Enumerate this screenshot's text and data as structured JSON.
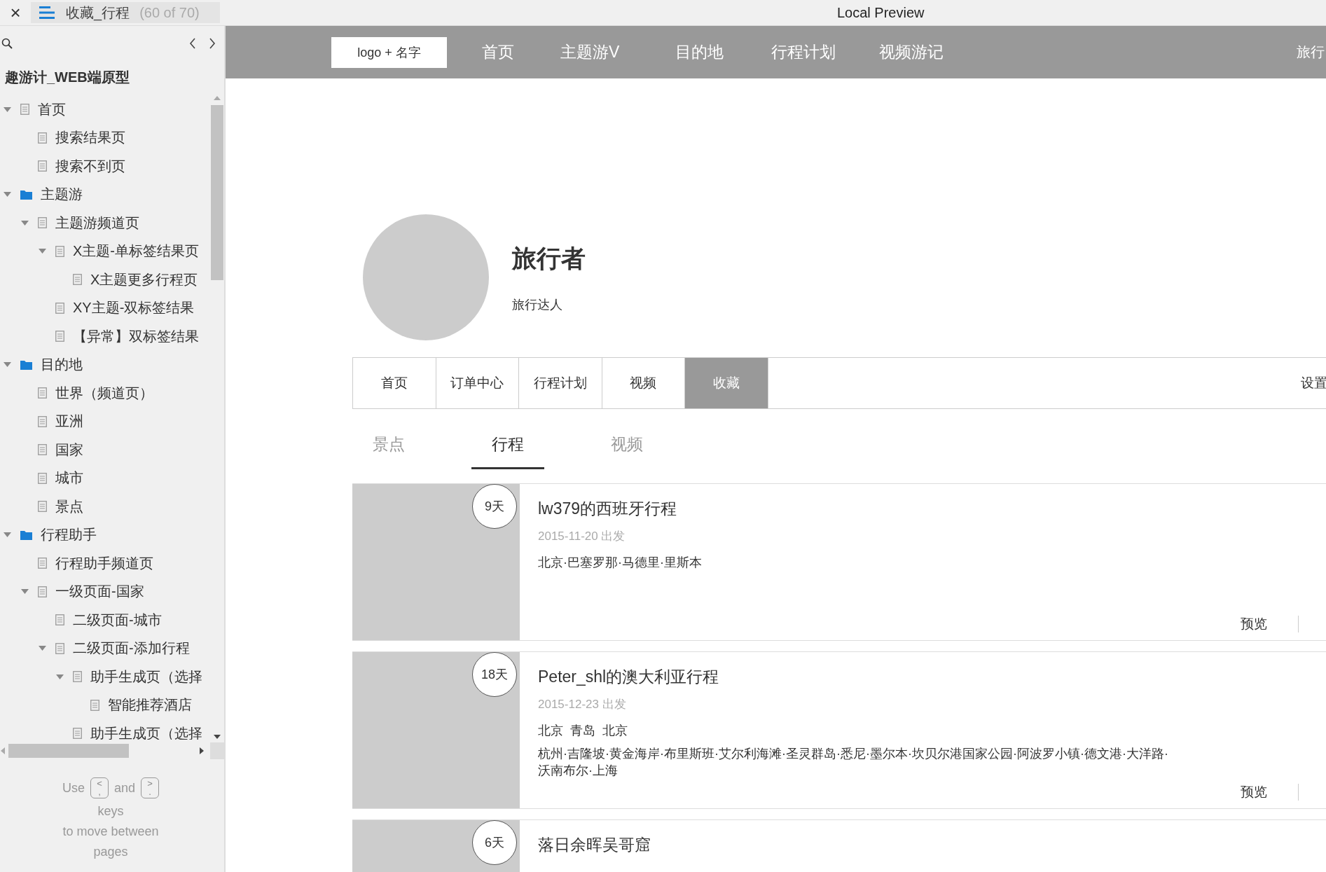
{
  "window": {
    "close": "×",
    "tab_title": "收藏_行程",
    "page_count": "(60 of 70)",
    "title": "Local Preview"
  },
  "sidebar": {
    "project": "趣游计_WEB端原型",
    "tree": [
      {
        "label": "首页",
        "kind": "page",
        "expanded": true,
        "children": [
          {
            "label": "搜索结果页",
            "kind": "page"
          },
          {
            "label": "搜索不到页",
            "kind": "page"
          }
        ]
      },
      {
        "label": "主题游",
        "kind": "folder",
        "expanded": true,
        "children": [
          {
            "label": "主题游频道页",
            "kind": "page",
            "expanded": true,
            "children": [
              {
                "label": "X主题-单标签结果页",
                "kind": "page",
                "expanded": true,
                "children": [
                  {
                    "label": "X主题更多行程页",
                    "kind": "page"
                  }
                ]
              },
              {
                "label": "XY主题-双标签结果",
                "kind": "page"
              },
              {
                "label": "【异常】双标签结果",
                "kind": "page"
              }
            ]
          }
        ]
      },
      {
        "label": "目的地",
        "kind": "folder",
        "expanded": true,
        "children": [
          {
            "label": "世界（频道页）",
            "kind": "page"
          },
          {
            "label": "亚洲",
            "kind": "page"
          },
          {
            "label": "国家",
            "kind": "page"
          },
          {
            "label": "城市",
            "kind": "page"
          },
          {
            "label": "景点",
            "kind": "page"
          }
        ]
      },
      {
        "label": "行程助手",
        "kind": "folder",
        "expanded": true,
        "children": [
          {
            "label": "行程助手频道页",
            "kind": "page"
          },
          {
            "label": "一级页面-国家",
            "kind": "page",
            "expanded": true,
            "children": [
              {
                "label": "二级页面-城市",
                "kind": "page"
              },
              {
                "label": "二级页面-添加行程",
                "kind": "page",
                "expanded": true,
                "children": [
                  {
                    "label": "助手生成页（选择",
                    "kind": "page",
                    "expanded": true,
                    "children": [
                      {
                        "label": "智能推荐酒店",
                        "kind": "page"
                      }
                    ]
                  },
                  {
                    "label": "助手生成页（选择",
                    "kind": "page"
                  }
                ]
              }
            ]
          }
        ]
      }
    ],
    "hint": {
      "use": "Use",
      "prev_key": [
        "<",
        ","
      ],
      "and": "and",
      "next_key": [
        ">",
        "."
      ],
      "rest": [
        "keys",
        "to move between",
        "pages"
      ]
    }
  },
  "site_nav": {
    "logo": "logo + 名字",
    "items": [
      "首页",
      "主题游V",
      "目的地",
      "行程计划",
      "视频游记"
    ],
    "user": "旅行"
  },
  "profile": {
    "name": "旅行者",
    "tagline": "旅行达人"
  },
  "profile_tabs": [
    {
      "label": "首页",
      "selected": false
    },
    {
      "label": "订单中心",
      "selected": false
    },
    {
      "label": "行程计划",
      "selected": false
    },
    {
      "label": "视频",
      "selected": false
    },
    {
      "label": "收藏",
      "selected": true
    }
  ],
  "settings": "设置",
  "collection_tabs": [
    {
      "label": "景点",
      "selected": false
    },
    {
      "label": "行程",
      "selected": true
    },
    {
      "label": "视频",
      "selected": false
    }
  ],
  "trips": [
    {
      "days": "9天",
      "title": "lw379的西班牙行程",
      "date": "2015-11-20 出发",
      "routes": [
        "北京·巴塞罗那·马德里·里斯本"
      ],
      "action": "预览"
    },
    {
      "days": "18天",
      "title": "Peter_shl的澳大利亚行程",
      "date": "2015-12-23 出发",
      "routes": [
        "北京  青岛  北京",
        "杭州·吉隆坡·黄金海岸·布里斯班·艾尔利海滩·圣灵群岛·悉尼·墨尔本·坎贝尔港国家公园·阿波罗小镇·德文港·大洋路·沃南布尔·上海"
      ],
      "action": "预览"
    },
    {
      "days": "6天",
      "title": "落日余晖吴哥窟"
    }
  ]
}
